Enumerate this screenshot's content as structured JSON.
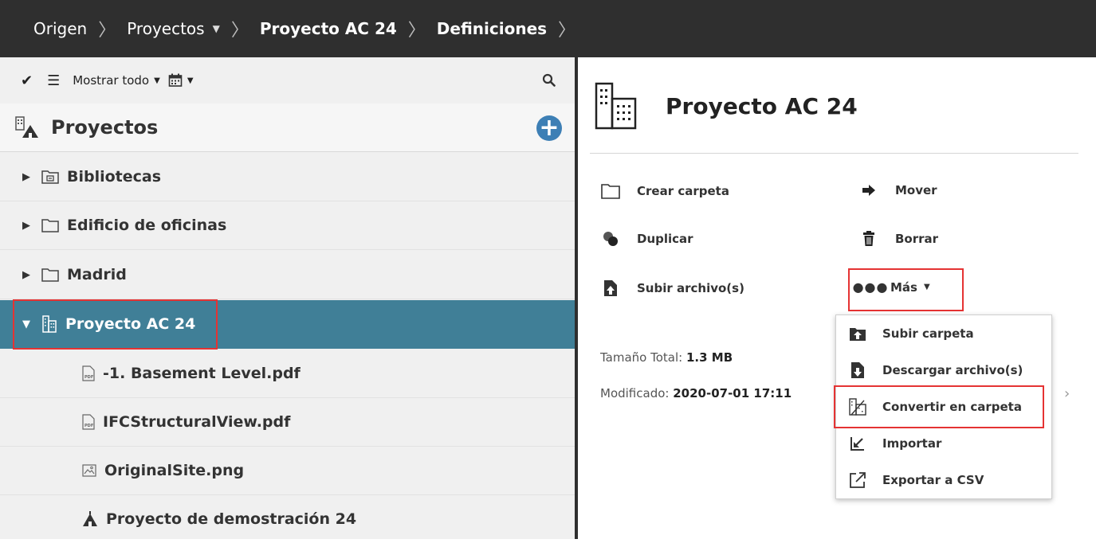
{
  "breadcrumb": {
    "items": [
      {
        "label": "Origen"
      },
      {
        "label": "Proyectos"
      },
      {
        "label": "Proyecto AC 24"
      },
      {
        "label": "Definiciones"
      }
    ]
  },
  "toolbar": {
    "show_all_label": "Mostrar todo"
  },
  "tree": {
    "header_title": "Proyectos",
    "items": [
      {
        "label": "Bibliotecas"
      },
      {
        "label": "Edificio de oficinas"
      },
      {
        "label": "Madrid"
      },
      {
        "label": "Proyecto AC 24"
      },
      {
        "label": "-1. Basement Level.pdf"
      },
      {
        "label": "IFCStructuralView.pdf"
      },
      {
        "label": "OriginalSite.png"
      },
      {
        "label": "Proyecto de demostración 24"
      }
    ]
  },
  "details": {
    "title": "Proyecto AC 24",
    "actions": {
      "create_folder": "Crear carpeta",
      "move": "Mover",
      "duplicate": "Duplicar",
      "delete": "Borrar",
      "upload_files": "Subir archivo(s)",
      "more": "Más"
    },
    "size_label": "Tamaño Total:",
    "size_value": "1.3 MB",
    "modified_label": "Modificado:",
    "modified_value": "2020-07-01 17:11"
  },
  "more_menu": {
    "items": [
      {
        "label": "Subir carpeta"
      },
      {
        "label": "Descargar archivo(s)"
      },
      {
        "label": "Convertir en carpeta"
      },
      {
        "label": "Importar"
      },
      {
        "label": "Exportar a CSV"
      }
    ]
  },
  "colors": {
    "topbar": "#2f2f2f",
    "selected_row": "#407f97",
    "highlight_box": "#e53333",
    "add_button": "#3d7fb5"
  }
}
